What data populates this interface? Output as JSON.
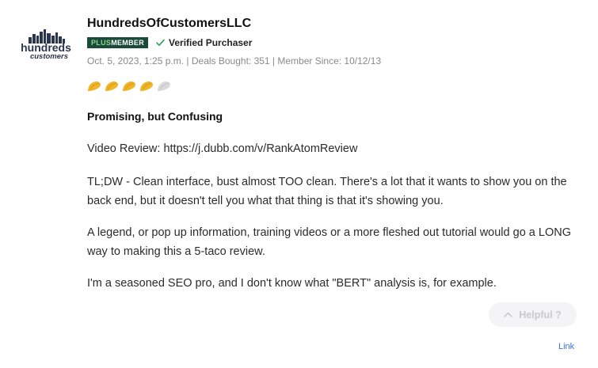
{
  "reviewer": {
    "name": "HundredsOfCustomersLLC",
    "badge_prefix": "PLUS",
    "badge_suffix": "MEMBER",
    "verified_label": "Verified Purchaser",
    "meta": "Oct. 5, 2023, 1:25 p.m. | Deals Bought: 351 | Member Since: 10/12/13",
    "logo_line1": "hundreds",
    "logo_line2": "customers"
  },
  "rating": {
    "value": 4,
    "max": 5,
    "icon": "taco-icon",
    "filled_color": "#f0b429",
    "empty_color": "#d9d9d9"
  },
  "review": {
    "title": "Promising, but Confusing",
    "paragraphs": [
      "Video Review: https://j.dubb.com/v/RankAtomReview",
      "TL;DW - Clean interface, bust almost TOO clean. There's a lot that it wants to show you on the back end, but it doesn't tell you what that thing is that it's showing you.",
      "A legend, or pop up information, training videos or a more fleshed out tutorial would go a LONG way to making this a 5-taco review.",
      "I'm a seasoned SEO pro, and I don't know what \"BERT\" analysis is, for example."
    ]
  },
  "actions": {
    "helpful_label": "Helpful ?",
    "link_label": "Link"
  },
  "colors": {
    "badge_bg": "#1a4b3a",
    "verified_check": "#2e9e5b",
    "link": "#3b6fd9"
  }
}
